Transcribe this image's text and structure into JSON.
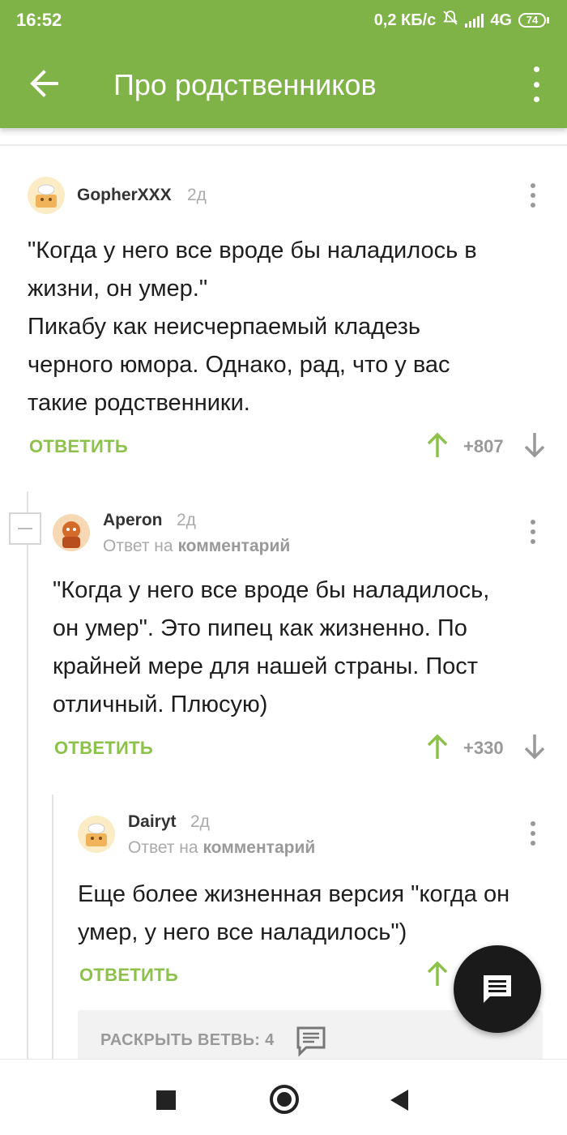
{
  "status_bar": {
    "time": "16:52",
    "network_speed": "0,2 КБ/с",
    "network_type": "4G",
    "battery": "74"
  },
  "app_bar": {
    "title": "Про родственников",
    "back_icon": "arrow-left-icon",
    "menu_icon": "more-vert-icon"
  },
  "comments": [
    {
      "author": "GopherXXX",
      "time": "2д",
      "text": "\"Когда у него все вроде бы наладилось в\nжизни, он умер.\"\nПикабу как неисчерпаемый кладезь\nчерного юмора. Однако, рад, что у вас\nтакие родственники.",
      "reply_label": "ОТВЕТИТЬ",
      "score": "+807"
    },
    {
      "author": "Aperon",
      "time": "2д",
      "reply_to_prefix": "Ответ на",
      "reply_to_link": "комментарий",
      "text": "\"Когда у него все вроде бы наладилось,\nон умер\". Это пипец как жизненно. По\nкрайней мере для нашей страны. Пост\nотличный. Плюсую)",
      "reply_label": "ОТВЕТИТЬ",
      "score": "+330"
    },
    {
      "author": "Dairyt",
      "time": "2д",
      "reply_to_prefix": "Ответ на",
      "reply_to_link": "комментарий",
      "text": "Еще более жизненная версия \"когда он\nумер, у него все наладилось\")",
      "reply_label": "ОТВЕТИТЬ"
    }
  ],
  "expand_branch": {
    "label": "РАСКРЫТЬ ВЕТВЬ: 4",
    "icon": "comments-icon"
  },
  "fab": {
    "icon": "comment-icon"
  },
  "nav_bar": {
    "recents_icon": "recents-square-icon",
    "home_icon": "home-circle-icon",
    "back_icon": "back-triangle-icon"
  },
  "colors": {
    "brand_green": "#7fb347",
    "reply_green": "#8cc14a",
    "muted_grey": "#999999"
  }
}
